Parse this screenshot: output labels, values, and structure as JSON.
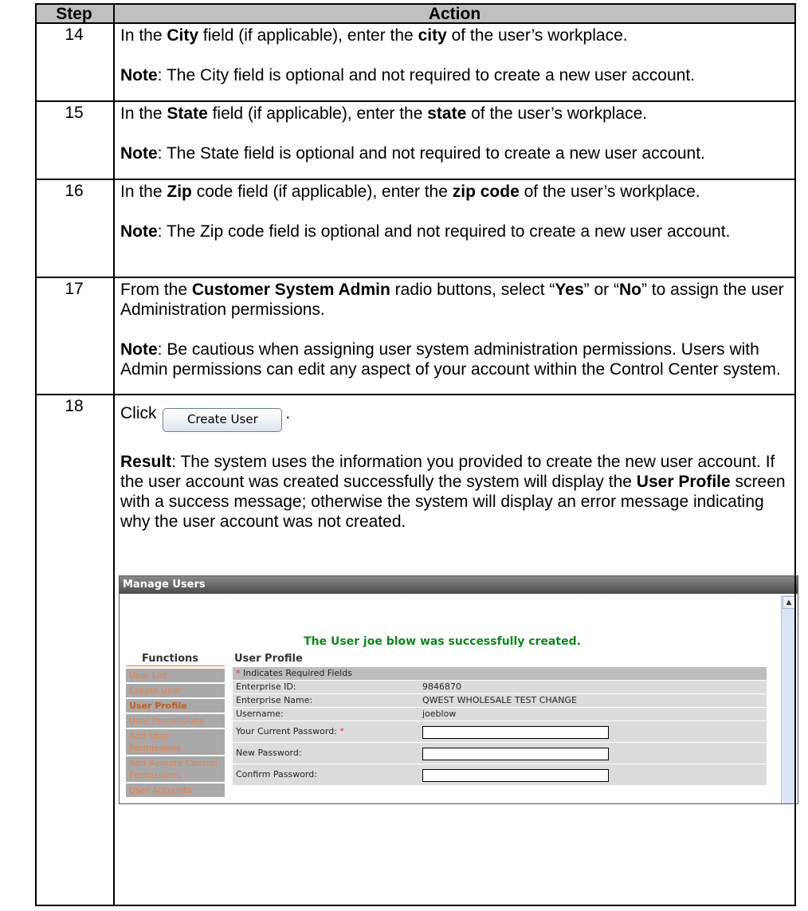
{
  "table": {
    "header": {
      "step": "Step",
      "action": "Action"
    },
    "rows": [
      {
        "step": "14",
        "line1_a": "In the ",
        "line1_b": "City",
        "line1_c": " field (if applicable), enter the ",
        "line1_d": "city",
        "line1_e": " of the user’s workplace.",
        "note_label": "Note",
        "note_text": ":  The City field is optional and not required to create a new user account."
      },
      {
        "step": "15",
        "line1_a": "In the ",
        "line1_b": "State",
        "line1_c": " field (if applicable), enter the ",
        "line1_d": "state",
        "line1_e": " of the user’s workplace.",
        "note_label": "Note",
        "note_text": ":  The State field is optional and not required to create a new user account."
      },
      {
        "step": "16",
        "line1_a": "In the ",
        "line1_b": "Zip",
        "line1_c": " code field (if applicable), enter the ",
        "line1_d": "zip code",
        "line1_e": " of the user’s workplace.",
        "note_label": "Note",
        "note_text": ":  The Zip code field is optional and not required to create a new user account."
      },
      {
        "step": "17",
        "line1_a": "From the ",
        "line1_b": "Customer System Admin",
        "line1_c": " radio buttons, select “",
        "line1_d": "Yes",
        "line1_e": "” or “",
        "line1_f": "No",
        "line1_g": "” to assign the user Administration permissions.",
        "note_label": "Note",
        "note_text": ":  Be cautious when assigning user system administration permissions.  Users with Admin permissions can edit any aspect of your account within the Control Center system."
      },
      {
        "step": "18",
        "click": "Click",
        "button_label": "Create User",
        "period": ".",
        "result_label": "Result",
        "result_a": ":  The system uses the information you provided to create the new user account.  If the user account was created successfully the system will display the ",
        "result_b": "User Profile",
        "result_c": " screen with a success message; otherwise the system will display an error message indicating why the user account was not created."
      }
    ]
  },
  "screenshot": {
    "title": "Manage Users",
    "success_message": "The User joe blow was successfully created.",
    "functions_title": "Functions",
    "functions": [
      {
        "label": "User List"
      },
      {
        "label": "Create User"
      },
      {
        "label": "User Profile"
      },
      {
        "label": "User Permissions"
      },
      {
        "label": "Add User Permissions"
      },
      {
        "label": "Add Remote Control Permissions"
      },
      {
        "label": "User Accounts"
      }
    ],
    "profile_title": "User Profile",
    "required_note": "Indicates Required Fields",
    "required_star": "*",
    "fields": [
      {
        "label": "Enterprise ID:",
        "value": "9846870"
      },
      {
        "label": "Enterprise Name:",
        "value": "QWEST WHOLESALE TEST CHANGE"
      },
      {
        "label": "Username:",
        "value": "joeblow"
      }
    ],
    "inputs": [
      {
        "label": "Your Current Password:",
        "required": "*"
      },
      {
        "label": "New Password:",
        "required": ""
      },
      {
        "label": "Confirm Password:",
        "required": ""
      }
    ]
  }
}
